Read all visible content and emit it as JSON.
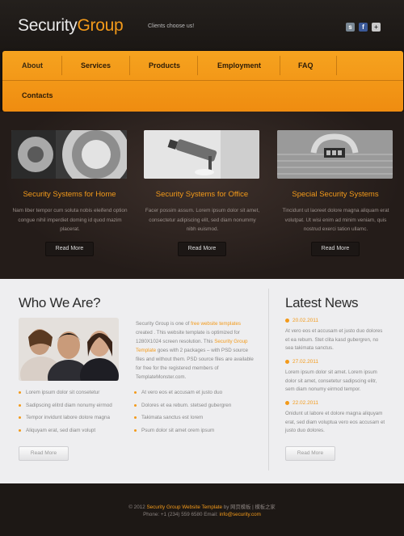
{
  "header": {
    "logo_part1": "Security",
    "logo_part2": "Group",
    "tagline": "Clients choose us!",
    "social": [
      "skype-icon",
      "facebook-icon",
      "plus-icon"
    ],
    "social_glyphs": [
      "s",
      "f",
      "+"
    ]
  },
  "nav": {
    "items": [
      "About",
      "Services",
      "Products",
      "Employment",
      "FAQ",
      "Contacts"
    ]
  },
  "features": [
    {
      "title": "Security Systems for Home",
      "text": "Nam liber tempor cum soluta nobis eleifend option congue nihil imperdiet doming id quod mazim placerat.",
      "button": "Read More",
      "image": "safe-dial-image"
    },
    {
      "title": "Security Systems for Office",
      "text": "Facer possim assum. Lorem ipsum dolor sit amet, consectetur adipiscing elit, sed diam nonummy nibh euismod.",
      "button": "Read More",
      "image": "security-camera-image"
    },
    {
      "title": "Special Security Systems",
      "text": "Tincidunt ut laoreet dolore magna aliquam erat volutpat. Ut wisi enim ad minim veniam, quis nostrud exerci tation ullamc.",
      "button": "Read More",
      "image": "briefcase-lock-image"
    }
  ],
  "who": {
    "heading": "Who We Are?",
    "text_a": "Security Group is one of ",
    "text_link1": "free website templates",
    "text_b": " created . This website template is optimized for 1280X1024 screen resolution. This ",
    "text_link2": "Security Group Template",
    "text_c": " goes with 2 packages – with PSD source files and without them. PSD source files are available for free for the registered members of TemplateMonster.com.",
    "list_left": [
      "Lorem ipsum dolor sit consetetur",
      "Sadipscing elitrd diam nonumy eirmod",
      "Tempor invidunt labore dolore magna",
      "Aliquyam erat, sed diam volupt"
    ],
    "list_right": [
      "At vero eos et accusam et justo duo",
      "Dolores et ea rebum. stetsed gubergren",
      "Takimata sanctus est lorem",
      "Psum dolor sit amet orem ipsum"
    ],
    "button": "Read More"
  },
  "news": {
    "heading": "Latest News",
    "items": [
      {
        "date": "20.02.2011",
        "text": "At vero eos et accusam et justo duo dolores et ea rebum. Stet clita kasd gubergren, no sea takimata sanctus."
      },
      {
        "date": "27.02.2011",
        "text": "Lorem ipsum dolor sit amet. Lorem ipsum dolor sit amet, consetetur sadipscing elitr, sem diam nonumy eirmod tempor."
      },
      {
        "date": "22.02.2011",
        "text": "Onidunt ut labore et dolore magna aliquyam erat, sed diam voluptua vero eos accusam et justo duo dolores."
      }
    ],
    "button": "Read More"
  },
  "footer": {
    "copy_pre": "© 2012 ",
    "copy_link": "Security Group Website Template",
    "copy_post": " by 网页模板 | 模板之家",
    "phone_label": "Phone: +1 (234) 559 6580  Email: ",
    "email": "info@security.com"
  }
}
